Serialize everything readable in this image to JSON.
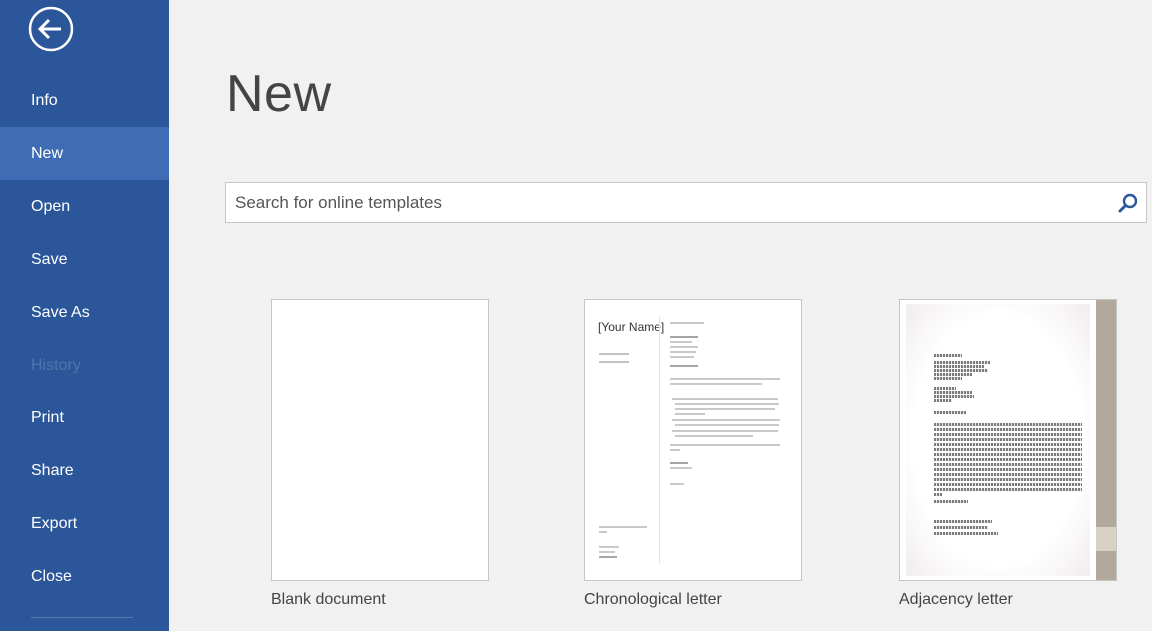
{
  "sidebar": {
    "back_label": "Back",
    "items": [
      {
        "label": "Info"
      },
      {
        "label": "New"
      },
      {
        "label": "Open"
      },
      {
        "label": "Save"
      },
      {
        "label": "Save As"
      },
      {
        "label": "History"
      },
      {
        "label": "Print"
      },
      {
        "label": "Share"
      },
      {
        "label": "Export"
      },
      {
        "label": "Close"
      }
    ],
    "active_item": "New",
    "disabled_item": "History"
  },
  "main": {
    "title": "New",
    "search": {
      "placeholder": "Search for online templates",
      "value": ""
    },
    "templates": [
      {
        "name": "Blank document"
      },
      {
        "name": "Chronological letter",
        "thumb_name": "[Your Name]"
      },
      {
        "name": "Adjacency letter"
      }
    ]
  },
  "colors": {
    "sidebar": "#2b579a",
    "sidebar_active": "#3e6db5",
    "background": "#f1f1f1",
    "text": "#444444"
  },
  "icons": {
    "back": "back-arrow-circle-icon",
    "search": "magnifier-icon"
  }
}
